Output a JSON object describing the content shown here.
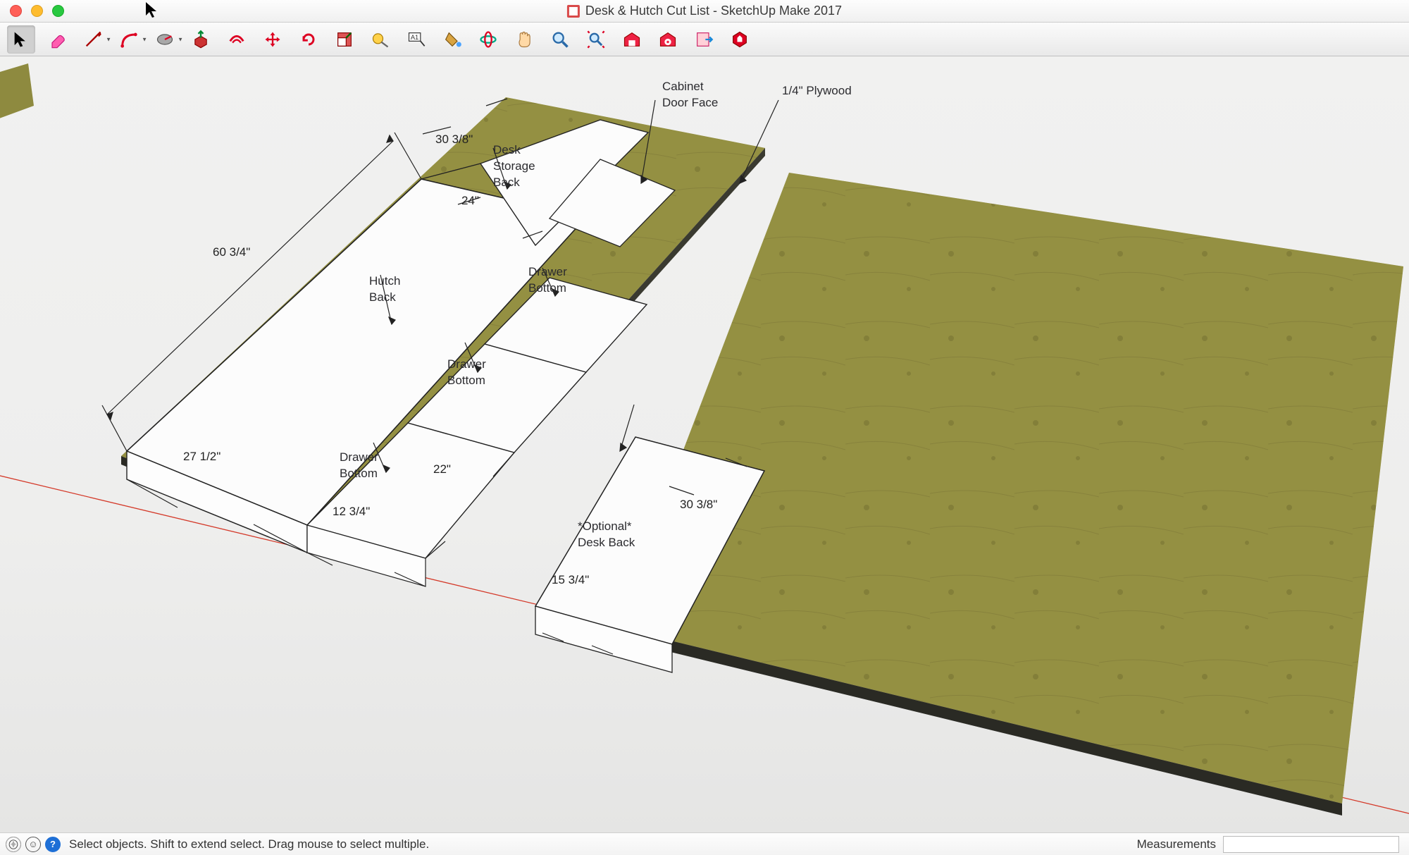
{
  "window": {
    "title": "Desk & Hutch Cut List - SketchUp Make 2017"
  },
  "toolbar": {
    "tools": [
      {
        "name": "select-tool",
        "glyph": "cursor",
        "active": true,
        "dropdown": false
      },
      {
        "name": "eraser-tool",
        "glyph": "eraser",
        "dropdown": false
      },
      {
        "name": "line-tool",
        "glyph": "pencil",
        "dropdown": true
      },
      {
        "name": "arc-tool",
        "glyph": "arc",
        "dropdown": true
      },
      {
        "name": "shape-tool",
        "glyph": "rect",
        "dropdown": true
      },
      {
        "name": "push-pull-tool",
        "glyph": "pushpull",
        "dropdown": false
      },
      {
        "name": "offset-tool",
        "glyph": "offset",
        "dropdown": false
      },
      {
        "name": "move-tool",
        "glyph": "move",
        "dropdown": false
      },
      {
        "name": "rotate-tool",
        "glyph": "rotate",
        "dropdown": false
      },
      {
        "name": "scale-tool",
        "glyph": "scale",
        "dropdown": false
      },
      {
        "name": "tape-measure-tool",
        "glyph": "tape",
        "dropdown": false
      },
      {
        "name": "text-tool",
        "glyph": "textlabel",
        "dropdown": false
      },
      {
        "name": "paint-bucket-tool",
        "glyph": "paint",
        "dropdown": false
      },
      {
        "name": "orbit-tool",
        "glyph": "orbit",
        "dropdown": false
      },
      {
        "name": "pan-tool",
        "glyph": "pan",
        "dropdown": false
      },
      {
        "name": "zoom-tool",
        "glyph": "zoom",
        "dropdown": false
      },
      {
        "name": "zoom-extents-tool",
        "glyph": "zoomextents",
        "dropdown": false
      },
      {
        "name": "3d-warehouse-tool",
        "glyph": "warehouse",
        "dropdown": false
      },
      {
        "name": "extension-warehouse-tool",
        "glyph": "extwarehouse",
        "dropdown": false
      },
      {
        "name": "layout-export-tool",
        "glyph": "layout",
        "dropdown": false
      },
      {
        "name": "extension-manager-tool",
        "glyph": "ruby",
        "dropdown": false
      }
    ]
  },
  "scene": {
    "material_label": "1/4\" Plywood",
    "parts": {
      "hutch_back": "Hutch\nBack",
      "desk_storage_back": "Desk\nStorage\nBack",
      "drawer_bottom_1": "Drawer\nBottom",
      "drawer_bottom_2": "Drawer\nBottom",
      "drawer_bottom_3": "Drawer\nBottom",
      "cabinet_door_face": "Cabinet\nDoor Face",
      "optional_desk_back": "*Optional*\nDesk Back"
    },
    "dimensions": {
      "left_height": "60 3/4\"",
      "hutch_width": "27 1/2\"",
      "top_width": "30 3/8\"",
      "desk_storage_width": "24\"",
      "drawer_width": "22\"",
      "drawer_depth": "12 3/4\"",
      "optional_width": "30 3/8\"",
      "optional_depth": "15 3/4\""
    }
  },
  "statusbar": {
    "hint": "Select objects. Shift to extend select. Drag mouse to select multiple.",
    "measurements_label": "Measurements",
    "measurements_value": ""
  }
}
